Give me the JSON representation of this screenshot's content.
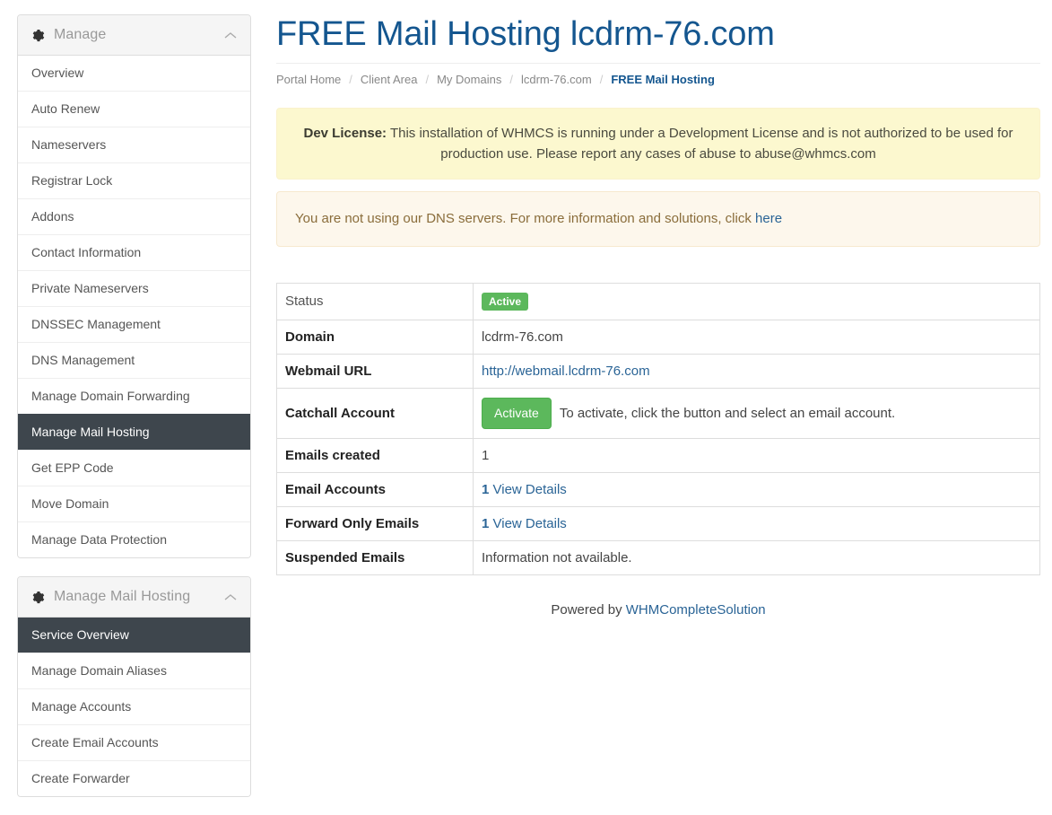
{
  "sidebar": {
    "panels": [
      {
        "title": "Manage",
        "icon": "gear-icon",
        "collapse_icon": "chevron-up-icon",
        "items": [
          {
            "label": "Overview",
            "active": false
          },
          {
            "label": "Auto Renew",
            "active": false
          },
          {
            "label": "Nameservers",
            "active": false
          },
          {
            "label": "Registrar Lock",
            "active": false
          },
          {
            "label": "Addons",
            "active": false
          },
          {
            "label": "Contact Information",
            "active": false
          },
          {
            "label": "Private Nameservers",
            "active": false
          },
          {
            "label": "DNSSEC Management",
            "active": false
          },
          {
            "label": "DNS Management",
            "active": false
          },
          {
            "label": "Manage Domain Forwarding",
            "active": false
          },
          {
            "label": "Manage Mail Hosting",
            "active": true
          },
          {
            "label": "Get EPP Code",
            "active": false
          },
          {
            "label": "Move Domain",
            "active": false
          },
          {
            "label": "Manage Data Protection",
            "active": false
          }
        ]
      },
      {
        "title": "Manage Mail Hosting",
        "icon": "gear-icon",
        "collapse_icon": "chevron-up-icon",
        "items": [
          {
            "label": "Service Overview",
            "active": true
          },
          {
            "label": "Manage Domain Aliases",
            "active": false
          },
          {
            "label": "Manage Accounts",
            "active": false
          },
          {
            "label": "Create Email Accounts",
            "active": false
          },
          {
            "label": "Create Forwarder",
            "active": false
          }
        ]
      }
    ]
  },
  "main": {
    "page_title": "FREE Mail Hosting lcdrm-76.com",
    "breadcrumb": [
      {
        "label": "Portal Home",
        "active": false
      },
      {
        "label": "Client Area",
        "active": false
      },
      {
        "label": "My Domains",
        "active": false
      },
      {
        "label": "lcdrm-76.com",
        "active": false
      },
      {
        "label": "FREE Mail Hosting",
        "active": true
      }
    ],
    "breadcrumb_separator": "/",
    "alerts": {
      "dev_license": {
        "strong": "Dev License:",
        "text": " This installation of WHMCS is running under a Development License and is not authorized to be used for production use. Please report any cases of abuse to abuse@whmcs.com"
      },
      "dns": {
        "text": "You are not using our DNS servers. For more information and solutions, click ",
        "link_label": "here"
      }
    },
    "table": {
      "rows": [
        {
          "label": "Status",
          "label_bold": false,
          "type": "badge",
          "badge_label": "Active"
        },
        {
          "label": "Domain",
          "label_bold": true,
          "type": "text",
          "value": "lcdrm-76.com"
        },
        {
          "label": "Webmail URL",
          "label_bold": true,
          "type": "link",
          "value": "http://webmail.lcdrm-76.com"
        },
        {
          "label": "Catchall Account",
          "label_bold": true,
          "type": "button",
          "button_label": "Activate",
          "value": "To activate, click the button and select an email account."
        },
        {
          "label": "Emails created",
          "label_bold": true,
          "type": "text",
          "value": "1"
        },
        {
          "label": "Email Accounts",
          "label_bold": true,
          "type": "count_link",
          "count": "1",
          "link_label": "View Details"
        },
        {
          "label": "Forward Only Emails",
          "label_bold": true,
          "type": "count_link",
          "count": "1",
          "link_label": "View Details"
        },
        {
          "label": "Suspended Emails",
          "label_bold": true,
          "type": "text",
          "value": "Information not available."
        }
      ]
    },
    "footer": {
      "powered_prefix": "Powered by ",
      "powered_link": "WHMCompleteSolution"
    }
  },
  "colors": {
    "accent_blue": "#14568f",
    "link_blue": "#2a6496",
    "success_green": "#5cb85c",
    "sidebar_active_bg": "#3e464d",
    "dev_alert_bg": "#fcf8cf",
    "dns_alert_bg": "#fdf7ec"
  }
}
